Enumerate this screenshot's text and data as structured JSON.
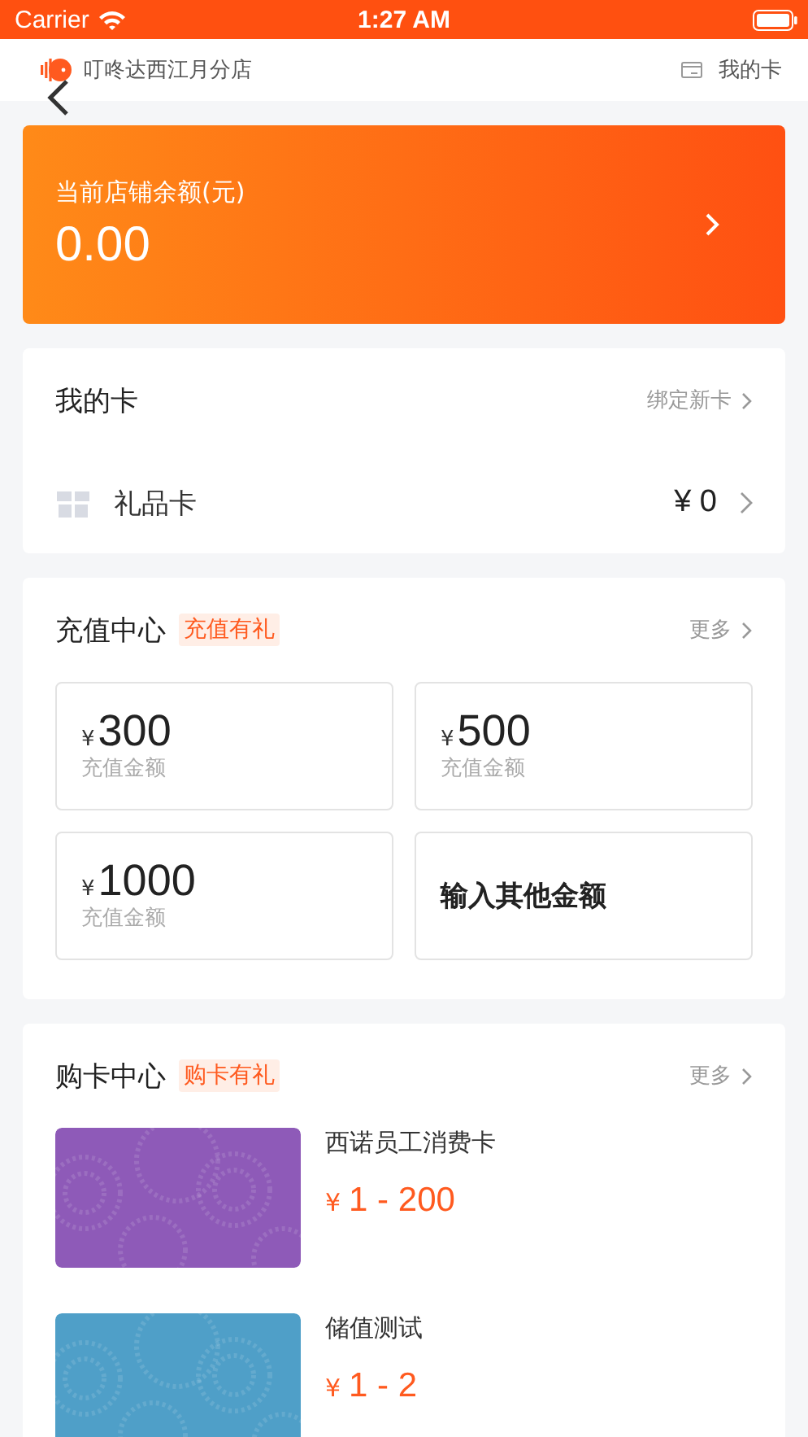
{
  "status_bar": {
    "carrier": "Carrier",
    "time": "1:27 AM"
  },
  "header": {
    "store_name": "叮咚达西江月分店",
    "my_cards": "我的卡"
  },
  "balance": {
    "label": "当前店铺余额(元)",
    "amount": "0.00"
  },
  "my_cards": {
    "title": "我的卡",
    "action": "绑定新卡",
    "items": [
      {
        "name": "礼品卡",
        "value": "¥ 0"
      }
    ]
  },
  "recharge": {
    "title": "充值中心",
    "tag": "充值有礼",
    "more": "更多",
    "options": [
      {
        "kind": "amount",
        "currency": "¥",
        "amount": "300",
        "label": "充值金额"
      },
      {
        "kind": "amount",
        "currency": "¥",
        "amount": "500",
        "label": "充值金额"
      },
      {
        "kind": "amount",
        "currency": "¥",
        "amount": "1000",
        "label": "充值金额"
      },
      {
        "kind": "custom",
        "label": "输入其他金额"
      }
    ]
  },
  "buy_cards": {
    "title": "购卡中心",
    "tag": "购卡有礼",
    "more": "更多",
    "cards": [
      {
        "name": "西诺员工消费卡",
        "currency": "¥",
        "range": "1 - 200",
        "color": "#8e5ab8"
      },
      {
        "name": "储值测试",
        "currency": "¥",
        "range": "1 - 2",
        "color": "#4f9fc8"
      }
    ]
  }
}
